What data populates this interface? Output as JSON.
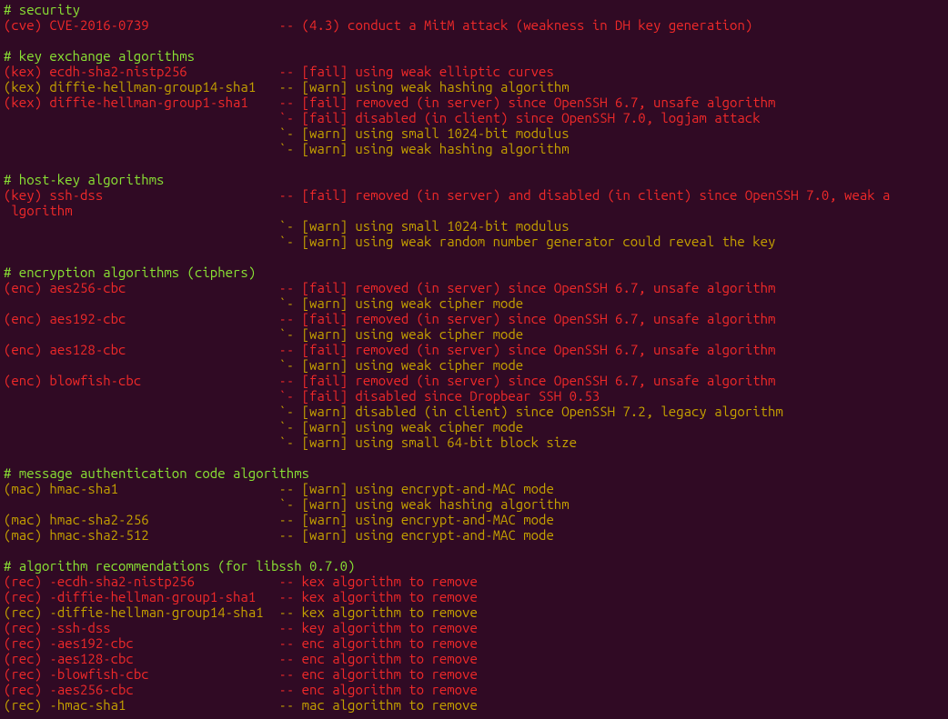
{
  "colors": {
    "bg": "#300a24",
    "green": "#8ae234",
    "red": "#ef2929",
    "yellow": "#c4a000",
    "white": "#d3d7cf"
  },
  "tool": "ssh-audit",
  "lines": [
    {
      "type": "section",
      "text": "# security"
    },
    {
      "type": "entry",
      "cat": "cve",
      "algo": "CVE-2016-0739",
      "sev": "red",
      "msg": "-- (4.3) conduct a MitM attack (weakness in DH key generation)"
    },
    {
      "type": "blank"
    },
    {
      "type": "section",
      "text": "# key exchange algorithms"
    },
    {
      "type": "entry",
      "cat": "kex",
      "algo": "ecdh-sha2-nistp256",
      "sev": "red",
      "msg": "-- [fail] using weak elliptic curves"
    },
    {
      "type": "entry",
      "cat": "kex",
      "algo": "diffie-hellman-group14-sha1",
      "sev": "yellow",
      "msg": "-- [warn] using weak hashing algorithm"
    },
    {
      "type": "entry",
      "cat": "kex",
      "algo": "diffie-hellman-group1-sha1",
      "sev": "red",
      "msg": "-- [fail] removed (in server) since OpenSSH 6.7, unsafe algorithm"
    },
    {
      "type": "cont",
      "sev": "red",
      "msg": "`- [fail] disabled (in client) since OpenSSH 7.0, logjam attack"
    },
    {
      "type": "cont",
      "sev": "yellow",
      "msg": "`- [warn] using small 1024-bit modulus"
    },
    {
      "type": "cont",
      "sev": "yellow",
      "msg": "`- [warn] using weak hashing algorithm"
    },
    {
      "type": "blank"
    },
    {
      "type": "section",
      "text": "# host-key algorithms"
    },
    {
      "type": "entry",
      "cat": "key",
      "algo": "ssh-dss",
      "sev": "red",
      "msg": "-- [fail] removed (in server) and disabled (in client) since OpenSSH 7.0, weak algorithm",
      "wrap": true
    },
    {
      "type": "cont",
      "sev": "yellow",
      "msg": "`- [warn] using small 1024-bit modulus"
    },
    {
      "type": "cont",
      "sev": "yellow",
      "msg": "`- [warn] using weak random number generator could reveal the key"
    },
    {
      "type": "blank"
    },
    {
      "type": "section",
      "text": "# encryption algorithms (ciphers)"
    },
    {
      "type": "entry",
      "cat": "enc",
      "algo": "aes256-cbc",
      "sev": "red",
      "msg": "-- [fail] removed (in server) since OpenSSH 6.7, unsafe algorithm"
    },
    {
      "type": "cont",
      "sev": "yellow",
      "msg": "`- [warn] using weak cipher mode"
    },
    {
      "type": "entry",
      "cat": "enc",
      "algo": "aes192-cbc",
      "sev": "red",
      "msg": "-- [fail] removed (in server) since OpenSSH 6.7, unsafe algorithm"
    },
    {
      "type": "cont",
      "sev": "yellow",
      "msg": "`- [warn] using weak cipher mode"
    },
    {
      "type": "entry",
      "cat": "enc",
      "algo": "aes128-cbc",
      "sev": "red",
      "msg": "-- [fail] removed (in server) since OpenSSH 6.7, unsafe algorithm"
    },
    {
      "type": "cont",
      "sev": "yellow",
      "msg": "`- [warn] using weak cipher mode"
    },
    {
      "type": "entry",
      "cat": "enc",
      "algo": "blowfish-cbc",
      "sev": "red",
      "msg": "-- [fail] removed (in server) since OpenSSH 6.7, unsafe algorithm"
    },
    {
      "type": "cont",
      "sev": "red",
      "msg": "`- [fail] disabled since Dropbear SSH 0.53"
    },
    {
      "type": "cont",
      "sev": "yellow",
      "msg": "`- [warn] disabled (in client) since OpenSSH 7.2, legacy algorithm"
    },
    {
      "type": "cont",
      "sev": "yellow",
      "msg": "`- [warn] using weak cipher mode"
    },
    {
      "type": "cont",
      "sev": "yellow",
      "msg": "`- [warn] using small 64-bit block size"
    },
    {
      "type": "blank"
    },
    {
      "type": "section",
      "text": "# message authentication code algorithms"
    },
    {
      "type": "entry",
      "cat": "mac",
      "algo": "hmac-sha1",
      "sev": "yellow",
      "msg": "-- [warn] using encrypt-and-MAC mode"
    },
    {
      "type": "cont",
      "sev": "yellow",
      "msg": "`- [warn] using weak hashing algorithm"
    },
    {
      "type": "entry",
      "cat": "mac",
      "algo": "hmac-sha2-256",
      "sev": "yellow",
      "msg": "-- [warn] using encrypt-and-MAC mode"
    },
    {
      "type": "entry",
      "cat": "mac",
      "algo": "hmac-sha2-512",
      "sev": "yellow",
      "msg": "-- [warn] using encrypt-and-MAC mode"
    },
    {
      "type": "blank"
    },
    {
      "type": "section",
      "text": "# algorithm recommendations (for libssh 0.7.0)"
    },
    {
      "type": "entry",
      "cat": "rec",
      "algo": "-ecdh-sha2-nistp256",
      "sev": "red",
      "msg": "-- kex algorithm to remove "
    },
    {
      "type": "entry",
      "cat": "rec",
      "algo": "-diffie-hellman-group1-sha1",
      "sev": "red",
      "msg": "-- kex algorithm to remove "
    },
    {
      "type": "entry",
      "cat": "rec",
      "algo": "-diffie-hellman-group14-sha1",
      "sev": "yellow",
      "msg": "-- kex algorithm to remove "
    },
    {
      "type": "entry",
      "cat": "rec",
      "algo": "-ssh-dss",
      "sev": "red",
      "msg": "-- key algorithm to remove "
    },
    {
      "type": "entry",
      "cat": "rec",
      "algo": "-aes192-cbc",
      "sev": "red",
      "msg": "-- enc algorithm to remove "
    },
    {
      "type": "entry",
      "cat": "rec",
      "algo": "-aes128-cbc",
      "sev": "red",
      "msg": "-- enc algorithm to remove "
    },
    {
      "type": "entry",
      "cat": "rec",
      "algo": "-blowfish-cbc",
      "sev": "red",
      "msg": "-- enc algorithm to remove "
    },
    {
      "type": "entry",
      "cat": "rec",
      "algo": "-aes256-cbc",
      "sev": "red",
      "msg": "-- enc algorithm to remove "
    },
    {
      "type": "entry",
      "cat": "rec",
      "algo": "-hmac-sha1",
      "sev": "yellow",
      "msg": "-- mac algorithm to remove "
    }
  ],
  "layout": {
    "msg_col": 36,
    "term_cols": 116
  }
}
